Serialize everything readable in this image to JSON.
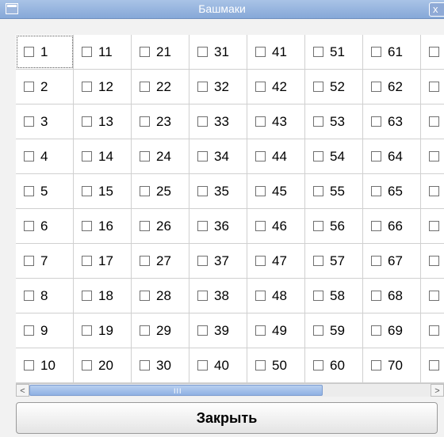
{
  "window": {
    "title": "Башмаки",
    "close_glyph": "x"
  },
  "grid": {
    "columns": [
      [
        "1",
        "2",
        "3",
        "4",
        "5",
        "6",
        "7",
        "8",
        "9",
        "10"
      ],
      [
        "11",
        "12",
        "13",
        "14",
        "15",
        "16",
        "17",
        "18",
        "19",
        "20"
      ],
      [
        "21",
        "22",
        "23",
        "24",
        "25",
        "26",
        "27",
        "28",
        "29",
        "30"
      ],
      [
        "31",
        "32",
        "33",
        "34",
        "35",
        "36",
        "37",
        "38",
        "39",
        "40"
      ],
      [
        "41",
        "42",
        "43",
        "44",
        "45",
        "46",
        "47",
        "48",
        "49",
        "50"
      ],
      [
        "51",
        "52",
        "53",
        "54",
        "55",
        "56",
        "57",
        "58",
        "59",
        "60"
      ],
      [
        "61",
        "62",
        "63",
        "64",
        "65",
        "66",
        "67",
        "68",
        "69",
        "70"
      ],
      [
        "",
        "",
        "",
        "",
        "",
        "",
        "",
        "",
        "",
        ""
      ]
    ],
    "focused_item": "1"
  },
  "scrollbar": {
    "left_arrow": "<",
    "right_arrow": ">",
    "grip": "III"
  },
  "footer": {
    "close_label": "Закрыть"
  }
}
